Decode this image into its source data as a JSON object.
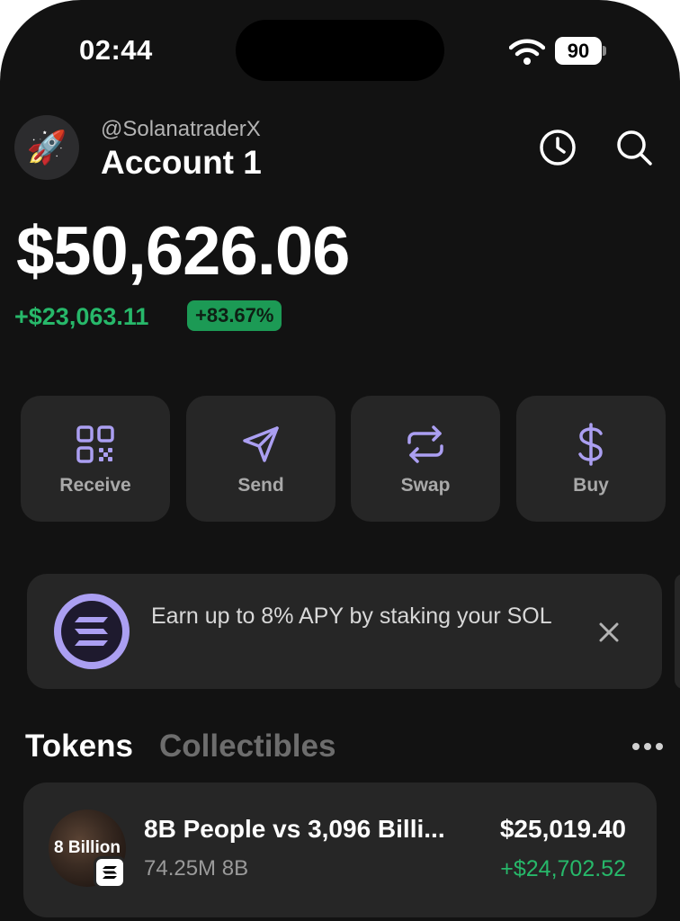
{
  "status_bar": {
    "time": "02:44",
    "battery": "90"
  },
  "header": {
    "handle": "@SolanatraderX",
    "account_name": "Account 1",
    "avatar_emoji": "🚀"
  },
  "balance": {
    "total": "$50,626.06",
    "change": "+$23,063.11",
    "change_pct": "+83.67%"
  },
  "actions": [
    {
      "label": "Receive",
      "icon": "qr-code-icon"
    },
    {
      "label": "Send",
      "icon": "send-icon"
    },
    {
      "label": "Swap",
      "icon": "swap-icon"
    },
    {
      "label": "Buy",
      "icon": "dollar-icon"
    }
  ],
  "banner": {
    "text": "Earn up to 8% APY by staking your SOL",
    "icon": "solana-logo-icon"
  },
  "tabs": [
    {
      "label": "Tokens",
      "active": true
    },
    {
      "label": "Collectibles",
      "active": false
    }
  ],
  "tokens": [
    {
      "image_text": "8 Billion",
      "name": "8B People vs 3,096 Billi...",
      "amount": "74.25M 8B",
      "value": "$25,019.40",
      "change": "+$24,702.52"
    }
  ],
  "colors": {
    "background": "#121212",
    "card": "#262626",
    "accent": "#ab9ff2",
    "positive": "#27b86a"
  }
}
